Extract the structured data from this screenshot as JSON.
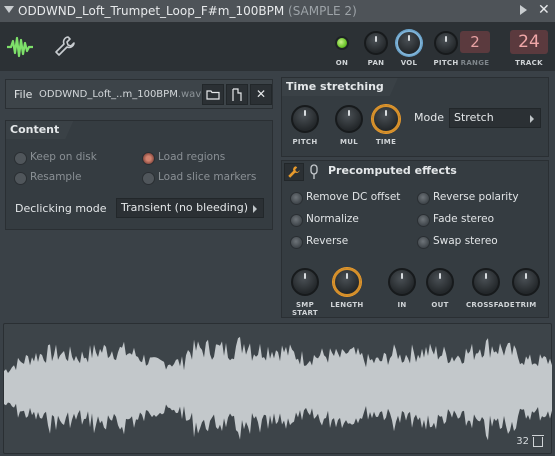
{
  "window": {
    "title": "ODDWND_Loft_Trumpet_Loop_F#m_100BPM",
    "subtitle": "(SAMPLE 2)"
  },
  "toolbar": {
    "on_label": "ON",
    "pan_label": "PAN",
    "vol_label": "VOL",
    "pitch_label": "PITCH",
    "range_label": "RANGE",
    "range_value": "2",
    "track_label": "TRACK",
    "track_value": "24"
  },
  "file": {
    "label": "File",
    "name_main": "ODDWND_Loft_..m_100BPM",
    "name_ext": ".wav"
  },
  "content": {
    "title": "Content",
    "options": [
      {
        "label": "Keep on disk",
        "checked": false
      },
      {
        "label": "Load regions",
        "checked": true
      },
      {
        "label": "Resample",
        "checked": false
      },
      {
        "label": "Load slice markers",
        "checked": false
      }
    ],
    "declicking_label": "Declicking mode",
    "declicking_value": "Transient (no bleeding)"
  },
  "time_stretching": {
    "title": "Time stretching",
    "knobs": [
      "PITCH",
      "MUL",
      "TIME"
    ],
    "mode_label": "Mode",
    "mode_value": "Stretch"
  },
  "precomputed": {
    "title": "Precomputed effects",
    "effects": [
      {
        "label": "Remove DC offset",
        "checked": false
      },
      {
        "label": "Reverse polarity",
        "checked": false
      },
      {
        "label": "Normalize",
        "checked": false
      },
      {
        "label": "Fade stereo",
        "checked": false
      },
      {
        "label": "Reverse",
        "checked": false
      },
      {
        "label": "Swap stereo",
        "checked": false
      }
    ],
    "knobs": [
      "SMP START",
      "LENGTH",
      "IN",
      "OUT",
      "CROSSFADE",
      "TRIM"
    ]
  },
  "waveform": {
    "zoom_value": "32"
  },
  "colors": {
    "accent_green": "#7ee06a",
    "accent_orange": "#e89a2c",
    "accent_blue": "#6aa6d0",
    "track_red": "#f0a7a8",
    "waveform": "#c3c8cb"
  }
}
